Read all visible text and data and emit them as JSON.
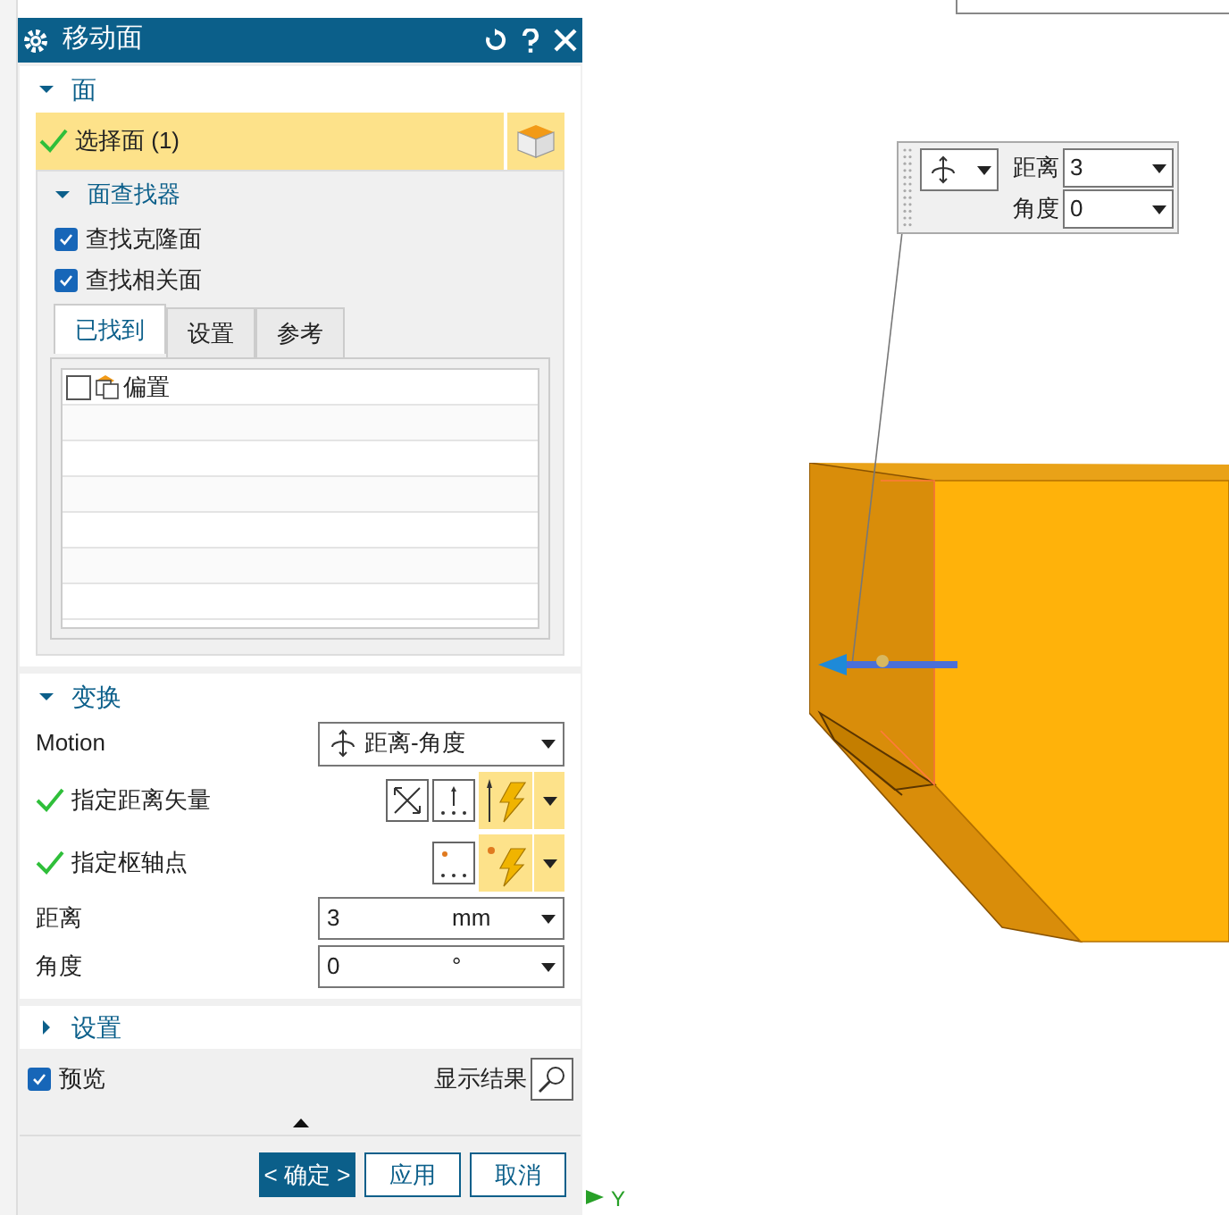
{
  "dialog": {
    "title": "移动面"
  },
  "face_section": {
    "title": "面",
    "expanded": true,
    "select": {
      "label": "选择面 (1)",
      "done": true
    },
    "finder": {
      "title": "面查找器",
      "expanded": true,
      "options": [
        {
          "label": "查找克隆面",
          "checked": true
        },
        {
          "label": "查找相关面",
          "checked": true
        }
      ],
      "tabs": [
        {
          "label": "已找到",
          "selected": true
        },
        {
          "label": "设置",
          "selected": false
        },
        {
          "label": "参考",
          "selected": false
        }
      ],
      "items": [
        {
          "label": "偏置",
          "checked": false
        }
      ]
    }
  },
  "transform_section": {
    "title": "变换",
    "expanded": true,
    "motion": {
      "label": "Motion",
      "value": "距离-角度"
    },
    "vector": {
      "label": "指定距离矢量",
      "done": true
    },
    "pivot": {
      "label": "指定枢轴点",
      "done": true
    },
    "distance": {
      "label": "距离",
      "value": "3",
      "unit": "mm"
    },
    "angle": {
      "label": "角度",
      "value": "0",
      "unit": "°"
    }
  },
  "settings_section": {
    "title": "设置",
    "expanded": false
  },
  "preview": {
    "label": "预览",
    "checked": true
  },
  "show_result": {
    "label": "显示结果"
  },
  "buttons": [
    {
      "label": "< 确定 >",
      "primary": true
    },
    {
      "label": "应用",
      "primary": false
    },
    {
      "label": "取消",
      "primary": false
    }
  ],
  "viewport": {
    "handle": {
      "distance_label": "距离",
      "distance": "3",
      "angle_label": "角度",
      "angle": "0"
    },
    "axis_label": "Y"
  }
}
